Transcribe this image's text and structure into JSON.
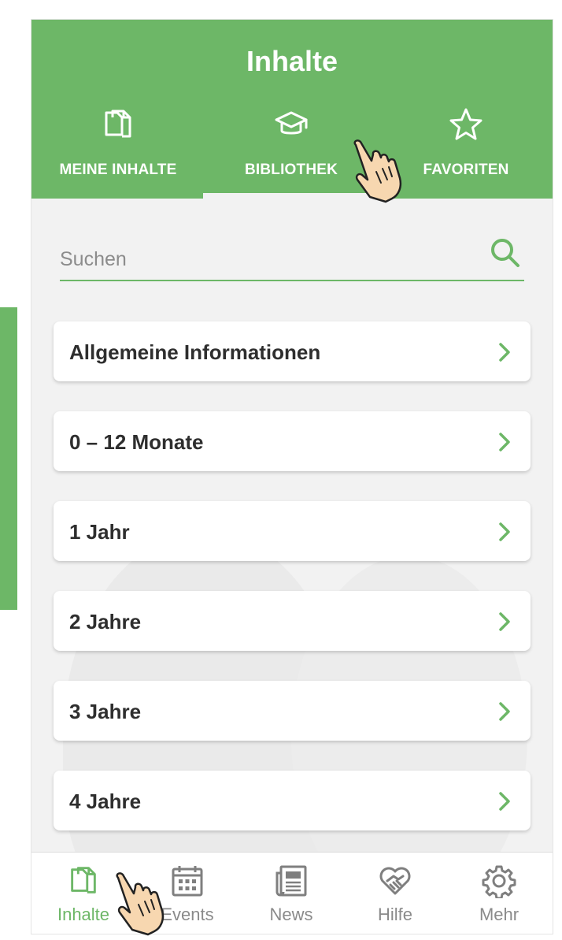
{
  "header": {
    "title": "Inhalte",
    "tabs": [
      {
        "label": "MEINE INHALTE",
        "icon": "document-icon"
      },
      {
        "label": "BIBLIOTHEK",
        "icon": "graduation-cap-icon",
        "selected": true
      },
      {
        "label": "FAVORITEN",
        "icon": "star-icon"
      }
    ]
  },
  "search": {
    "placeholder": "Suchen",
    "value": ""
  },
  "categories": [
    {
      "label": "Allgemeine Informationen"
    },
    {
      "label": "0 – 12 Monate"
    },
    {
      "label": "1 Jahr"
    },
    {
      "label": "2 Jahre"
    },
    {
      "label": "3 Jahre"
    },
    {
      "label": "4 Jahre"
    }
  ],
  "bottom_nav": [
    {
      "label": "Inhalte",
      "icon": "document-icon",
      "active": true
    },
    {
      "label": "Events",
      "icon": "calendar-icon"
    },
    {
      "label": "News",
      "icon": "newspaper-icon"
    },
    {
      "label": "Hilfe",
      "icon": "heart-handshake-icon"
    },
    {
      "label": "Mehr",
      "icon": "gear-icon"
    }
  ],
  "colors": {
    "accent": "#6db767",
    "background": "#f2f2f2",
    "card": "#ffffff",
    "text": "#2e2e2e",
    "inactive": "#8a8a8a"
  }
}
